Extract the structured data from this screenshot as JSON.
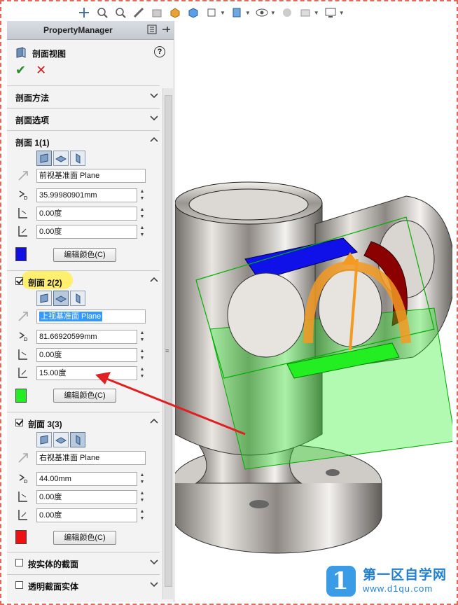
{
  "panel": {
    "title": "PropertyManager",
    "feature_name": "剖面视图",
    "help": "?",
    "ok": "✔",
    "cancel": "✕"
  },
  "groups": {
    "method": {
      "title": "剖面方法"
    },
    "options": {
      "title": "剖面选项"
    },
    "section1": {
      "title": "剖面 1(1)",
      "plane": "前视基准面 Plane",
      "offset": "35.99980901mm",
      "angle1": "0.00度",
      "angle2": "0.00度",
      "color_button": "编辑颜色(C)",
      "color": "#1010e0"
    },
    "section2": {
      "title": "剖面 2(2)",
      "checked": true,
      "plane": "上视基准面 Plane",
      "offset": "81.66920599mm",
      "angle1": "0.00度",
      "angle2": "15.00度",
      "color_button": "编辑颜色(C)",
      "color": "#22ee22"
    },
    "section3": {
      "title": "剖面 3(3)",
      "checked": true,
      "plane": "右视基准面 Plane",
      "offset": "44.00mm",
      "angle1": "0.00度",
      "angle2": "0.00度",
      "color_button": "编辑颜色(C)",
      "color": "#ee1111"
    },
    "by_body": {
      "title": "按实体的截面",
      "checked": false
    },
    "transparent": {
      "title": "透明截面实体",
      "checked": false
    }
  },
  "logo": {
    "name": "第一区自学网",
    "url": "www.d1qu.com",
    "mark": "1"
  },
  "colors": {
    "accent_arrow": "#e02020",
    "highlight": "#ffee66",
    "selection": "#3399ff"
  }
}
